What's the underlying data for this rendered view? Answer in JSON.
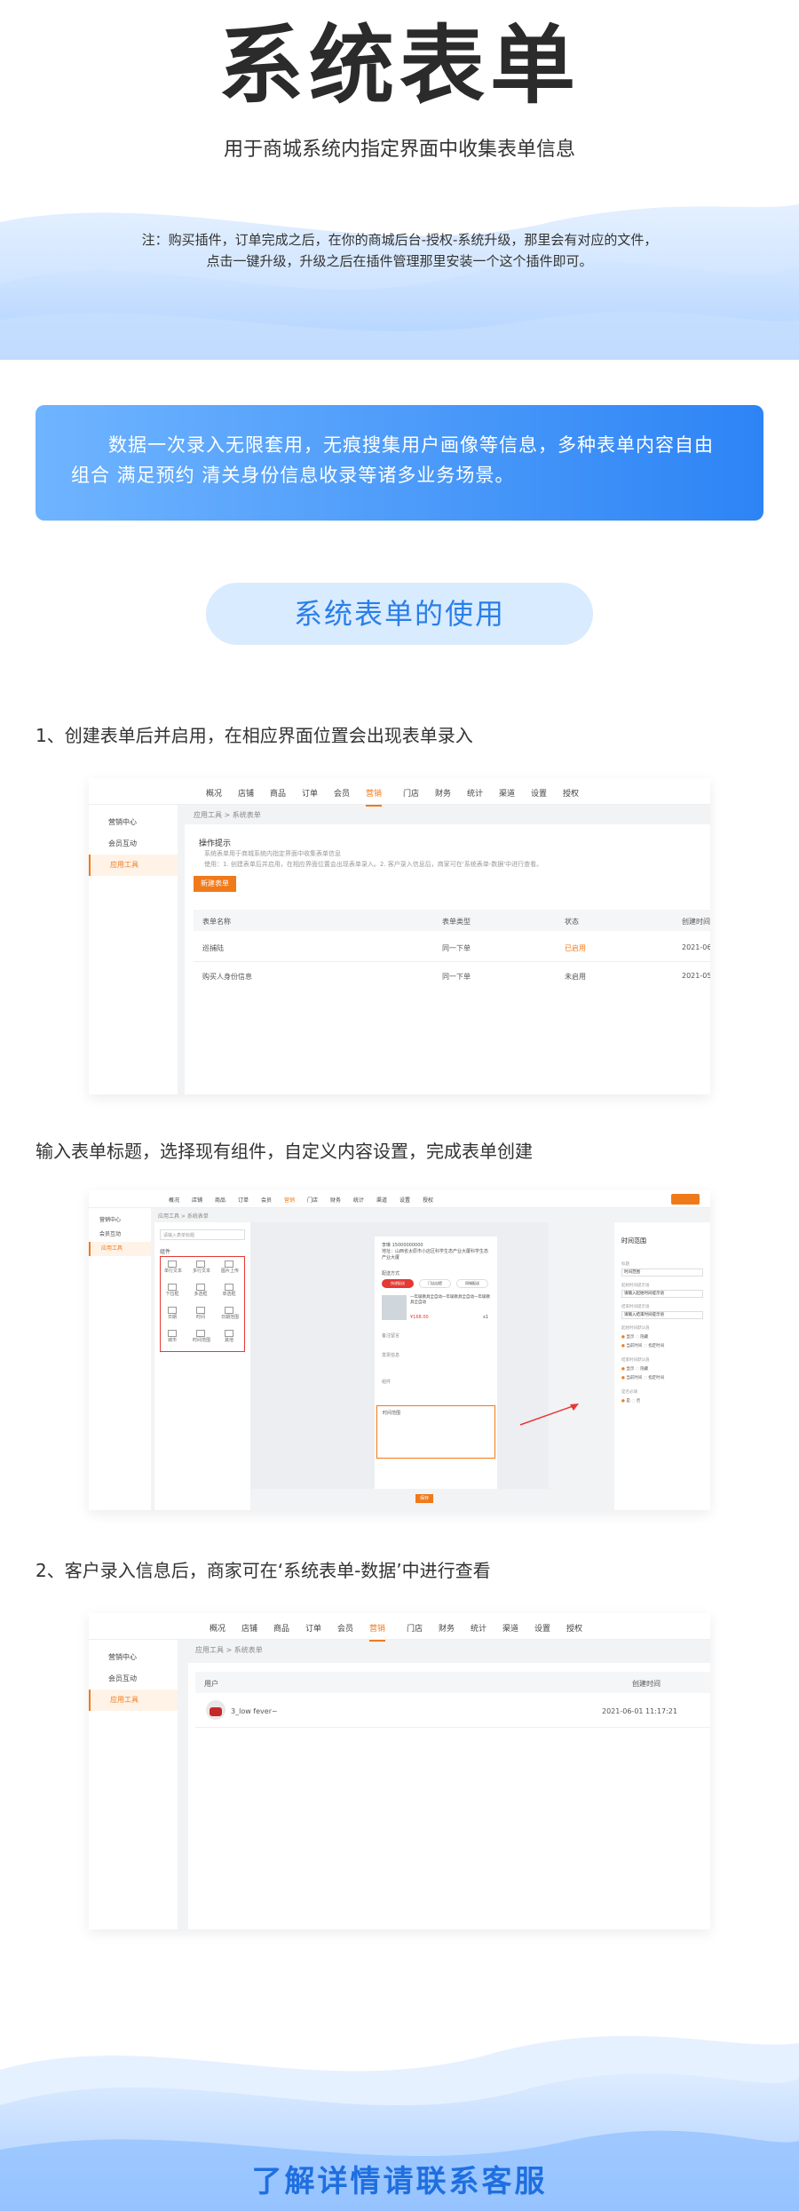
{
  "hero": {
    "title": "系统表单",
    "subtitle": "用于商城系统内指定界面中收集表单信息",
    "note_line1": "注：购买插件，订单完成之后，在你的商城后台-授权-系统升级，那里会有对应的文件，",
    "note_line2": "点击一键升级，升级之后在插件管理那里安装一个这个插件即可。"
  },
  "banner": {
    "text": "数据一次录入无限套用，无痕搜集用户画像等信息，多种表单内容自由组合  满足预约 清关身份信息收录等诸多业务场景。"
  },
  "section_title": "系统表单的使用",
  "steps": {
    "step1": "1、创建表单后并启用，在相应界面位置会出现表单录入",
    "step1b": "输入表单标题，选择现有组件，自定义内容设置，完成表单创建",
    "step2": "2、客户录入信息后，商家可在‘系统表单-数据’中进行查看"
  },
  "admin_nav": [
    "概况",
    "店铺",
    "商品",
    "订单",
    "会员",
    "营销",
    "门店",
    "财务",
    "统计",
    "渠道",
    "设置",
    "授权"
  ],
  "admin_nav_active": "营销",
  "admin_side": [
    "营销中心",
    "会员互动",
    "应用工具"
  ],
  "shot1": {
    "breadcrumb": "应用工具 > 系统表单",
    "tips_title": "操作提示",
    "tip1": "系统表单用于商城系统内指定界面中收集表单信息",
    "tip2": "使用：1. 创建表单后并启用，在相应界面位置会出现表单录入。2. 客户录入信息后，商家可在'系统表单-数据'中进行查看。",
    "new_button": "新建表单",
    "columns": [
      "表单名称",
      "表单类型",
      "状态",
      "创建时间"
    ],
    "rows": [
      [
        "巡捕陆",
        "同一下单",
        "已启用",
        "2021-06-"
      ],
      [
        "购买人身份信息",
        "同一下单",
        "未启用",
        "2021-05-"
      ]
    ]
  },
  "shot2": {
    "breadcrumb": "应用工具 > 系统表单",
    "title_placeholder": "请输入表单标题",
    "group_label": "组件",
    "components": [
      "单行文本",
      "多行文本",
      "图片上传",
      "下拉框",
      "多选框",
      "单选框",
      "日期",
      "时间",
      "日期范围",
      "城市",
      "时间范围",
      "其他"
    ],
    "phone_contact": "李琳 15000000000",
    "phone_address": "地址：山西省太原市小店区科学生态产业大厦科学生态产业大厦",
    "phone_delivery": "配送方式",
    "phone_delivery_opts": [
      "快递配送",
      "门店自提",
      "同城配送"
    ],
    "phone_product": "一年级教具全自动一年级教具全自动一年级教具全自动",
    "phone_price": "¥168.00",
    "phone_qty": "x1",
    "phone_fields": [
      "备注留言",
      "发票信息",
      "组件"
    ],
    "phone_time_label": "时间范围",
    "save_button": "保存",
    "right_title": "时间范围",
    "right_labels": [
      "标题",
      "时间范围",
      "起始时间提示语",
      "请输入起始时间提示语",
      "结束时间提示语",
      "请输入结束时间提示语",
      "起始时间默认值",
      "结束时间默认值",
      "是否必填"
    ],
    "right_options": [
      "显示",
      "隐藏",
      "当前时间",
      "指定时间",
      "是",
      "否"
    ]
  },
  "shot3": {
    "breadcrumb": "应用工具 > 系统表单",
    "columns": [
      "用户",
      "创建时间"
    ],
    "user": "3_low fever~",
    "time": "2021-06-01 11:17:21"
  },
  "footer": {
    "cta": "了解详情请联系客服"
  }
}
